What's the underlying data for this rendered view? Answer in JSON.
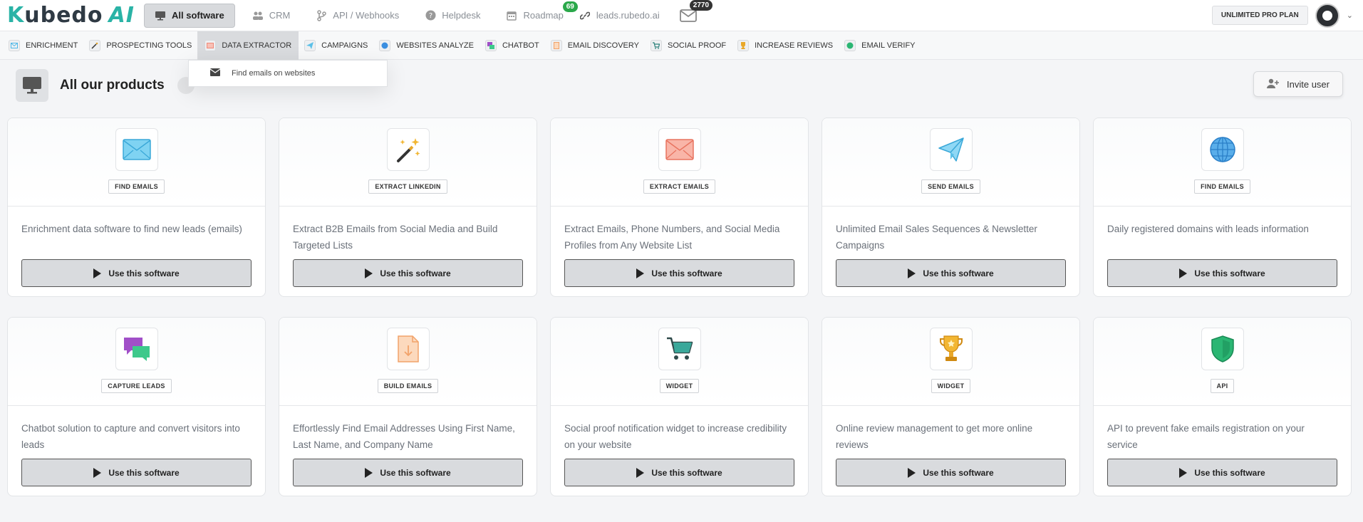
{
  "brand": {
    "logo_k": "K",
    "logo_text": "ubedo",
    "logo_ai": "AI"
  },
  "topnav": [
    {
      "label": "All software",
      "icon": "monitor-icon",
      "active": true
    },
    {
      "label": "CRM",
      "icon": "people-icon"
    },
    {
      "label": "API / Webhooks",
      "icon": "branch-icon"
    },
    {
      "label": "Helpdesk",
      "icon": "help-icon"
    },
    {
      "label": "Roadmap",
      "icon": "calendar-icon",
      "badge": "69"
    },
    {
      "label": "leads.rubedo.ai",
      "icon": "link-icon"
    },
    {
      "label": "",
      "icon": "mail-icon",
      "badge": "2770"
    }
  ],
  "plan_label": "UNLIMITED PRO PLAN",
  "subnav": [
    {
      "label": "ENRICHMENT",
      "icon": "envelope-icon",
      "color": "#4fb8e8"
    },
    {
      "label": "PROSPECTING TOOLS",
      "icon": "wand-icon",
      "color": "#e0a32a"
    },
    {
      "label": "DATA EXTRACTOR",
      "icon": "envelope-icon",
      "color": "#f08a7a",
      "active": true
    },
    {
      "label": "CAMPAIGNS",
      "icon": "plane-icon",
      "color": "#5bc0e8"
    },
    {
      "label": "WEBSITES ANALYZE",
      "icon": "globe-icon",
      "color": "#3a8ee0"
    },
    {
      "label": "CHATBOT",
      "icon": "chat-icon",
      "color": "#a14fc8"
    },
    {
      "label": "EMAIL DISCOVERY",
      "icon": "file-icon",
      "color": "#f2a36a"
    },
    {
      "label": "SOCIAL PROOF",
      "icon": "cart-icon",
      "color": "#2a7f7a"
    },
    {
      "label": "INCREASE REVIEWS",
      "icon": "trophy-icon",
      "color": "#e9a82a"
    },
    {
      "label": "EMAIL VERIFY",
      "icon": "shield-icon",
      "color": "#2bb673"
    }
  ],
  "dropdown": {
    "item": "Find emails on websites"
  },
  "page_title": "All our products",
  "invite_label": "Invite user",
  "use_label": "Use this software",
  "cards": [
    {
      "tag": "FIND EMAILS",
      "desc": "Enrichment data software to find new leads (emails)",
      "icon": "envelope-blue-icon"
    },
    {
      "tag": "EXTRACT LINKEDIN",
      "desc": "Extract B2B Emails from Social Media and Build Targeted Lists",
      "icon": "magic-wand-icon"
    },
    {
      "tag": "EXTRACT EMAILS",
      "desc": "Extract Emails, Phone Numbers, and Social Media Profiles from Any Website List",
      "icon": "envelope-red-icon"
    },
    {
      "tag": "SEND EMAILS",
      "desc": "Unlimited Email Sales Sequences & Newsletter Campaigns",
      "icon": "paper-plane-icon"
    },
    {
      "tag": "FIND EMAILS",
      "desc": "Daily registered domains with leads information",
      "icon": "globe-icon"
    },
    {
      "tag": "CAPTURE LEADS",
      "desc": "Chatbot solution to capture and convert visitors into leads",
      "icon": "chat-bubbles-icon"
    },
    {
      "tag": "BUILD EMAILS",
      "desc": "Effortlessly Find Email Addresses Using First Name, Last Name, and Company Name",
      "icon": "file-download-icon"
    },
    {
      "tag": "WIDGET",
      "desc": "Social proof notification widget to increase credibility on your website",
      "icon": "cart-icon"
    },
    {
      "tag": "WIDGET",
      "desc": "Online review management to get more online reviews",
      "icon": "trophy-icon"
    },
    {
      "tag": "API",
      "desc": "API to prevent fake emails registration on your service",
      "icon": "shield-icon"
    }
  ]
}
